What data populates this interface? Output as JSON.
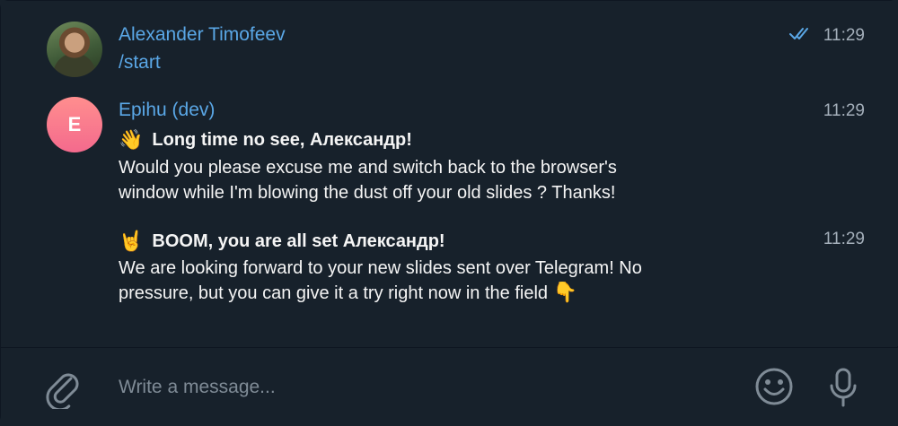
{
  "messages": [
    {
      "sender": "Alexander Timofeev",
      "text": "/start",
      "time": "11:29",
      "status": "read",
      "avatar": {
        "type": "photo"
      }
    },
    {
      "sender": "Epihu (dev)",
      "avatar": {
        "type": "letter",
        "letter": "E"
      },
      "time": "11:29",
      "title_emoji": "👋",
      "title": "Long time no see, Александр!",
      "body_lines": [
        "Would you please excuse me and switch back to the browser's",
        "window while I'm blowing the dust off your old slides ? Thanks!"
      ]
    },
    {
      "time": "11:29",
      "title_emoji": "🤘",
      "title": "BOOM, you are all set Александр!",
      "body_lines": [
        "We are looking forward to your new slides sent over Telegram! No",
        "pressure, but you can give it a try right now in the field"
      ],
      "body_end_emoji": "👇"
    }
  ],
  "composer": {
    "placeholder": "Write a message...",
    "icons": [
      "paperclip-icon",
      "emoji-icon",
      "microphone-icon"
    ]
  },
  "colors": {
    "background": "#17212b",
    "accent": "#5aa7e6",
    "text": "#f5f5f5",
    "muted": "#a4afba"
  }
}
